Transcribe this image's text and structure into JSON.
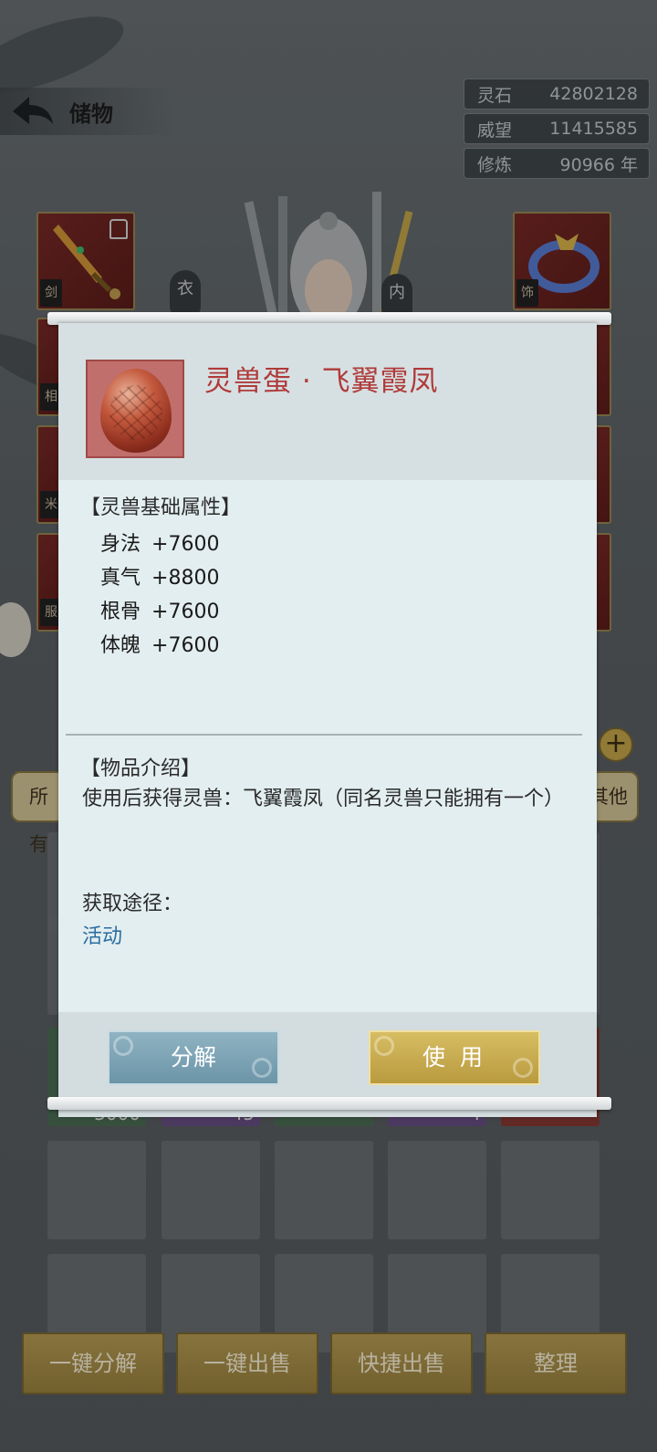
{
  "header": {
    "title": "储物"
  },
  "resources": [
    {
      "label": "灵石",
      "value": "42802128"
    },
    {
      "label": "威望",
      "value": "11415585"
    },
    {
      "label": "修炼",
      "value": "90966 年"
    }
  ],
  "equipment": {
    "slot_seals": [
      "剑",
      "饰",
      "相",
      "米",
      "服"
    ],
    "char_labels": [
      "衣",
      "内"
    ]
  },
  "categories": {
    "left": "所有",
    "right": "其他"
  },
  "grid_counts": [
    "3000",
    "45",
    "4"
  ],
  "bottom_buttons": [
    "一键分解",
    "一键出售",
    "快捷出售",
    "整理"
  ],
  "dialog": {
    "item_name": "灵兽蛋 · 飞翼霞凤",
    "attr_section_title": "【灵兽基础属性】",
    "attributes": [
      {
        "name": "身法",
        "value": "+7600"
      },
      {
        "name": "真气",
        "value": "+8800"
      },
      {
        "name": "根骨",
        "value": "+7600"
      },
      {
        "name": "体魄",
        "value": "+7600"
      }
    ],
    "intro_title": "【物品介绍】",
    "intro_text": "使用后获得灵兽：飞翼霞凤（同名灵兽只能拥有一个）",
    "source_label": "获取途径：",
    "source_value": "活动",
    "decompose_label": "分解",
    "use_label": "使 用"
  },
  "colors": {
    "item_name": "#b03a3a",
    "source_link": "#2b6ea0",
    "use_button": "#c9ad50",
    "decompose_button": "#7fa5b6"
  }
}
